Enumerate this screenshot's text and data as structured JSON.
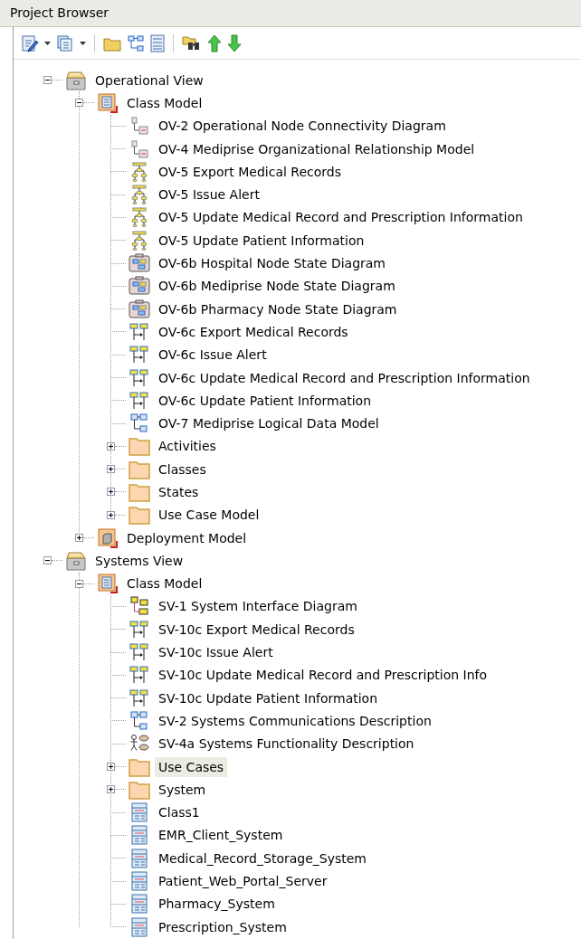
{
  "window": {
    "title": "Project Browser"
  },
  "tree": [
    {
      "label": "Operational View",
      "kind": "view",
      "expanded": true,
      "selected": false,
      "children": [
        {
          "label": "Class Model",
          "kind": "package",
          "expanded": true,
          "selected": false,
          "children": [
            {
              "label": "OV-2 Operational Node Connectivity Diagram",
              "kind": "node",
              "selected": false
            },
            {
              "label": "OV-4 Mediprise Organizational Relationship Model",
              "kind": "node",
              "selected": false
            },
            {
              "label": "OV-5 Export Medical Records",
              "kind": "activity",
              "selected": false
            },
            {
              "label": "OV-5 Issue Alert",
              "kind": "activity",
              "selected": false
            },
            {
              "label": "OV-5 Update Medical Record and Prescription Information",
              "kind": "activity",
              "selected": false
            },
            {
              "label": "OV-5 Update Patient Information",
              "kind": "activity",
              "selected": false
            },
            {
              "label": "OV-6b Hospital Node State Diagram",
              "kind": "state",
              "selected": false
            },
            {
              "label": "OV-6b Mediprise Node State Diagram",
              "kind": "state",
              "selected": false
            },
            {
              "label": "OV-6b Pharmacy Node State Diagram",
              "kind": "state",
              "selected": false
            },
            {
              "label": "OV-6c Export Medical Records",
              "kind": "sequence",
              "selected": false
            },
            {
              "label": "OV-6c Issue Alert",
              "kind": "sequence",
              "selected": false
            },
            {
              "label": "OV-6c Update Medical Record and Prescription Information",
              "kind": "sequence",
              "selected": false
            },
            {
              "label": "OV-6c Update Patient Information",
              "kind": "sequence",
              "selected": false
            },
            {
              "label": "OV-7 Mediprise Logical Data Model",
              "kind": "classdiagram",
              "selected": false
            },
            {
              "label": "Activities",
              "kind": "folder",
              "expanded": false,
              "selected": false
            },
            {
              "label": "Classes",
              "kind": "folder",
              "expanded": false,
              "selected": false
            },
            {
              "label": "States",
              "kind": "folder",
              "expanded": false,
              "selected": false
            },
            {
              "label": "Use Case Model",
              "kind": "folder",
              "expanded": false,
              "selected": false
            }
          ]
        },
        {
          "label": "Deployment Model",
          "kind": "deployment",
          "expanded": false,
          "selected": false
        }
      ]
    },
    {
      "label": "Systems View",
      "kind": "view",
      "expanded": true,
      "selected": false,
      "children": [
        {
          "label": "Class Model",
          "kind": "package",
          "expanded": true,
          "selected": false,
          "children": [
            {
              "label": "SV-1 System Interface Diagram",
              "kind": "interface",
              "selected": false
            },
            {
              "label": "SV-10c Export Medical Records",
              "kind": "sequence",
              "selected": false
            },
            {
              "label": "SV-10c Issue Alert",
              "kind": "sequence",
              "selected": false
            },
            {
              "label": "SV-10c Update Medical Record and Prescription Info",
              "kind": "sequence",
              "selected": false
            },
            {
              "label": "SV-10c Update Patient Information",
              "kind": "sequence",
              "selected": false
            },
            {
              "label": "SV-2 Systems Communications Description",
              "kind": "classdiagram",
              "selected": false
            },
            {
              "label": "SV-4a Systems Functionality Description",
              "kind": "usecase",
              "selected": false
            },
            {
              "label": "Use Cases",
              "kind": "folder",
              "expanded": false,
              "selected": true
            },
            {
              "label": "System",
              "kind": "folder",
              "expanded": false,
              "selected": false
            },
            {
              "label": "Class1",
              "kind": "class",
              "selected": false
            },
            {
              "label": "EMR_Client_System",
              "kind": "class",
              "selected": false
            },
            {
              "label": "Medical_Record_Storage_System",
              "kind": "class",
              "selected": false
            },
            {
              "label": "Patient_Web_Portal_Server",
              "kind": "class",
              "selected": false
            },
            {
              "label": "Pharmacy_System",
              "kind": "class",
              "selected": false
            },
            {
              "label": "Prescription_System",
              "kind": "class",
              "selected": false
            }
          ]
        }
      ]
    }
  ]
}
